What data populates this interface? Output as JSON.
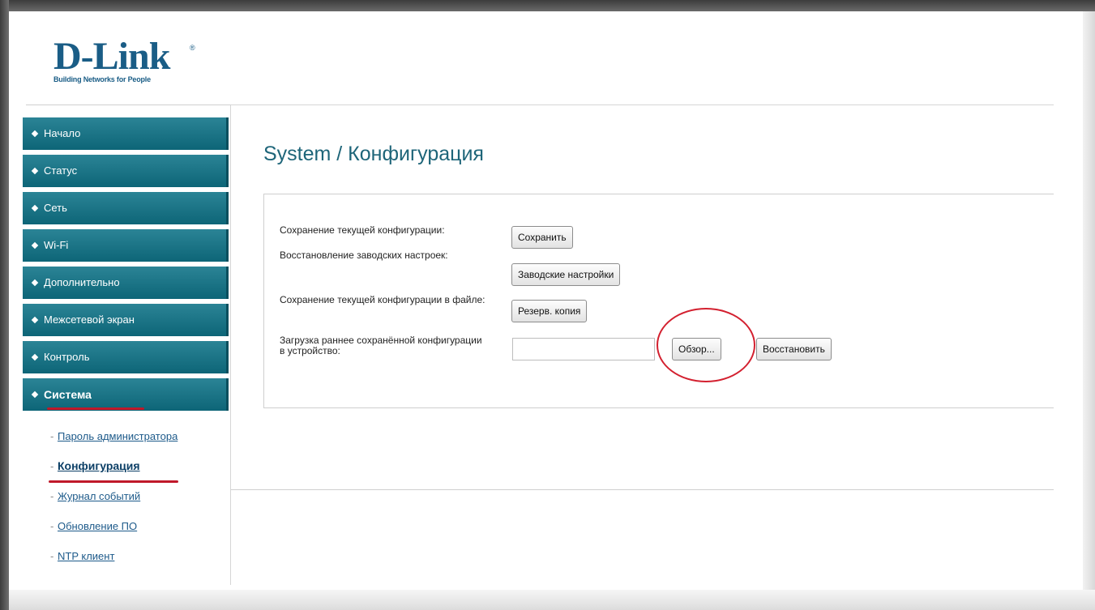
{
  "logo": {
    "name": "D-Link",
    "registered": "®",
    "tagline": "Building Networks for People"
  },
  "menu": {
    "items": [
      {
        "label": "Начало"
      },
      {
        "label": "Статус"
      },
      {
        "label": "Сеть"
      },
      {
        "label": "Wi-Fi"
      },
      {
        "label": "Дополнительно"
      },
      {
        "label": "Межсетевой экран"
      },
      {
        "label": "Контроль"
      },
      {
        "label": "Система",
        "active": true
      }
    ],
    "submenu": [
      {
        "label": "Пароль администратора"
      },
      {
        "label": "Конфигурация",
        "active": true
      },
      {
        "label": "Журнал событий"
      },
      {
        "label": "Обновление ПО"
      },
      {
        "label": "NTP клиент"
      }
    ]
  },
  "page": {
    "title": "System / Конфигурация"
  },
  "config": {
    "save_label": "Сохранение текущей конфигурации:",
    "save_button": "Сохранить",
    "factory_label": "Восстановление заводских настроек:",
    "factory_button": "Заводские настройки",
    "backup_label": "Сохранение текущей конфигурации в файле:",
    "backup_button": "Резерв. копия",
    "restore_label": "Загрузка раннее сохранённой конфигурации в устройство:",
    "file_value": "",
    "browse_button": "Обзор...",
    "restore_button": "Восстановить"
  },
  "colors": {
    "menu_bg": "#136f81",
    "accent_blue": "#1a5d86",
    "highlight_red": "#d3202f"
  }
}
